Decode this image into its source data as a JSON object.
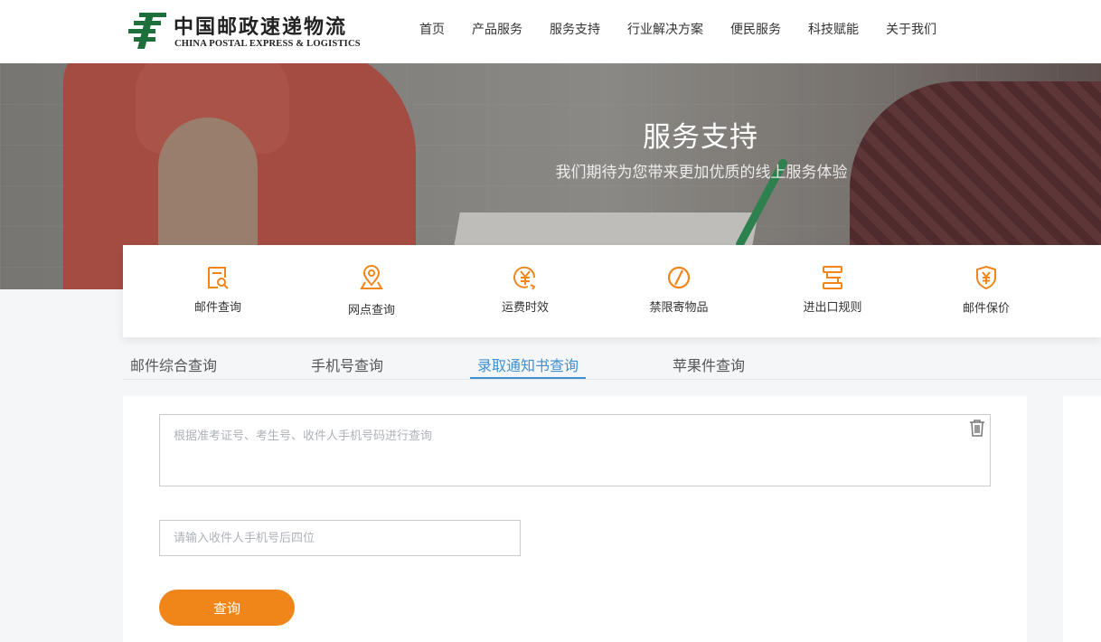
{
  "header": {
    "logo_cn": "中国邮政速递物流",
    "logo_en": "CHINA POSTAL EXPRESS & LOGISTICS",
    "nav": [
      "首页",
      "产品服务",
      "服务支持",
      "行业解决方案",
      "便民服务",
      "科技赋能",
      "关于我们"
    ]
  },
  "banner": {
    "title": "服务支持",
    "subtitle": "我们期待为您带来更加优质的线上服务体验"
  },
  "services": [
    {
      "label": "邮件查询",
      "icon": "document-search-icon"
    },
    {
      "label": "网点查询",
      "icon": "location-pin-icon"
    },
    {
      "label": "运费时效",
      "icon": "yuan-clock-icon"
    },
    {
      "label": "禁限寄物品",
      "icon": "prohibited-icon"
    },
    {
      "label": "进出口规则",
      "icon": "rules-list-icon"
    },
    {
      "label": "邮件保价",
      "icon": "yuan-shield-icon"
    }
  ],
  "tabs": [
    "邮件综合查询",
    "手机号查询",
    "录取通知书查询",
    "苹果件查询"
  ],
  "active_tab": "录取通知书查询",
  "form": {
    "textarea_placeholder": "根据准考证号、考生号、收件人手机号码进行查询",
    "phone_placeholder": "请输入收件人手机号后四位",
    "submit_label": "查询"
  },
  "colors": {
    "accent_orange": "#f08519",
    "tab_active_blue": "#3f8fd2",
    "logo_green": "#1d6f3b"
  }
}
